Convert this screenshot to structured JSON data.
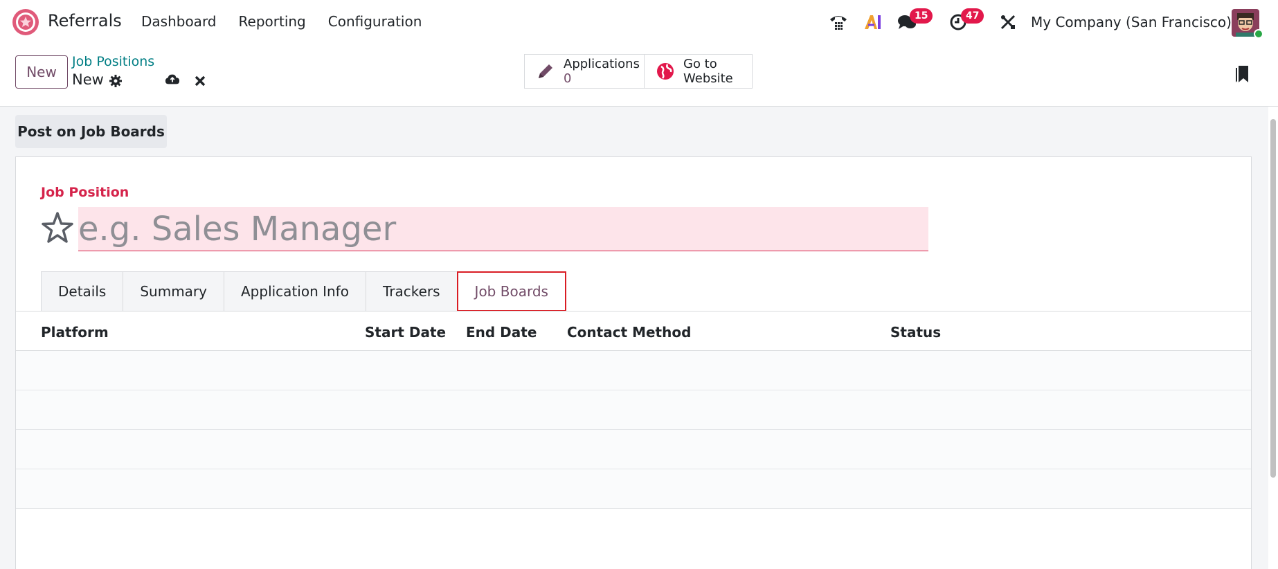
{
  "navbar": {
    "app_name": "Referrals",
    "menu": [
      "Dashboard",
      "Reporting",
      "Configuration"
    ],
    "discuss_count": "15",
    "activity_count": "47",
    "company": "My Company (San Francisco)"
  },
  "control_panel": {
    "new_label": "New",
    "breadcrumb_parent": "Job Positions",
    "breadcrumb_current": "New",
    "applications_label": "Applications",
    "applications_value": "0",
    "website_label_1": "Go to",
    "website_label_2": "Website"
  },
  "form": {
    "post_button": "Post on Job Boards",
    "job_position_label": "Job Position",
    "name_placeholder": "e.g. Sales Manager",
    "tabs": [
      "Details",
      "Summary",
      "Application Info",
      "Trackers",
      "Job Boards"
    ],
    "active_tab": "Job Boards",
    "columns": [
      "Platform",
      "Start Date",
      "End Date",
      "Contact Method",
      "Status"
    ]
  },
  "colors": {
    "brand": "#714b67",
    "required": "#d5244b",
    "link": "#017e84",
    "badge": "#e2184b",
    "highlight": "#d91c24"
  }
}
